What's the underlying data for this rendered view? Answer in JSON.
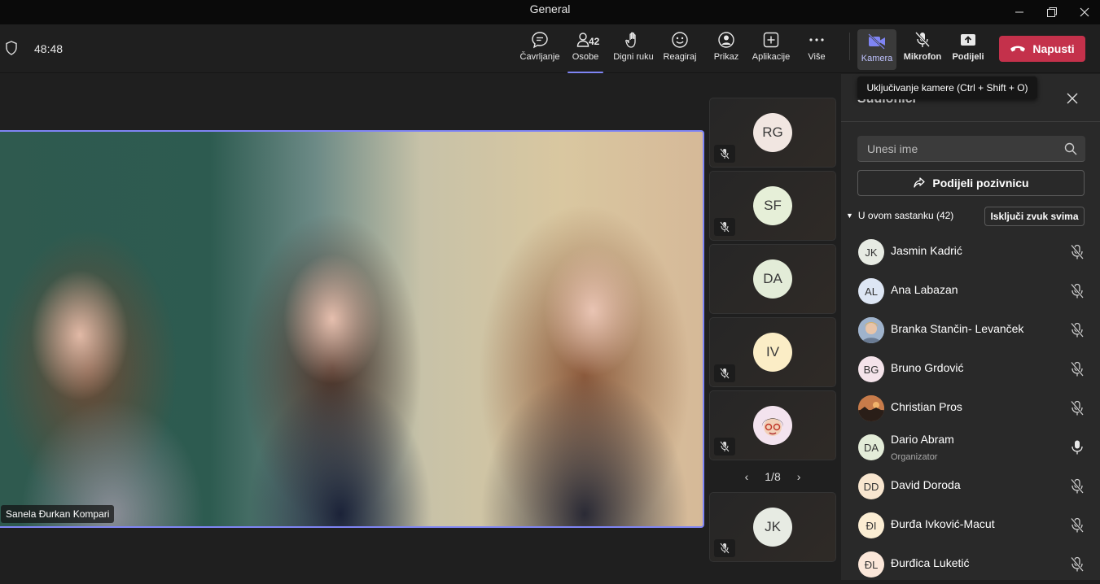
{
  "window": {
    "title": "General",
    "controls": [
      "minimize",
      "restore",
      "close"
    ]
  },
  "toolbar": {
    "timer": "48:48",
    "buttons": {
      "chat": "Čavrljanje",
      "people": "Osobe",
      "people_count": "42",
      "raise_hand": "Digni ruku",
      "react": "Reagiraj",
      "view": "Prikaz",
      "apps": "Aplikacije",
      "more": "Više",
      "camera": "Kamera",
      "mic": "Mikrofon",
      "share": "Podijeli"
    },
    "leave_label": "Napusti",
    "tooltip": "Uključivanje kamere (Ctrl + Shift + O)",
    "accent_color": "#7f85f5",
    "leave_color": "#c4314b"
  },
  "stage": {
    "main_speaker_name": "Sanela Đurkan Kompari",
    "tiles": [
      {
        "initials": "RG",
        "color": "#f1e6e1",
        "muted": true
      },
      {
        "initials": "SF",
        "color": "#e6efd8",
        "muted": true
      },
      {
        "initials": "DA",
        "color": "#e3ecd8",
        "muted": false
      },
      {
        "initials": "IV",
        "color": "#fbedc6",
        "muted": true
      },
      {
        "initials": "",
        "color": "#f3e3ee",
        "muted": true
      },
      {
        "initials": "JK",
        "color": "#e7ebe3",
        "muted": true
      }
    ],
    "pager": "1/8"
  },
  "panel": {
    "title": "Sudionici",
    "search_placeholder": "Unesi ime",
    "share_invite": "Podijeli pozivnicu",
    "section_label": "U ovom sastanku (42)",
    "mute_all": "Isključi zvuk svima",
    "participants": [
      {
        "initials": "JK",
        "name": "Jasmin Kadrić",
        "role": "",
        "color": "#e7ebe3",
        "muted": true
      },
      {
        "initials": "AL",
        "name": "Ana Labazan",
        "role": "",
        "color": "#dde6f4",
        "muted": true
      },
      {
        "initials": "",
        "name": "Branka Stančin- Levanček",
        "role": "",
        "color": "#b4c2d6",
        "muted": true
      },
      {
        "initials": "BG",
        "name": "Bruno Grdović",
        "role": "",
        "color": "#f4e3ea",
        "muted": true
      },
      {
        "initials": "",
        "name": "Christian Pros",
        "role": "",
        "color": "#8a6245",
        "muted": true
      },
      {
        "initials": "DA",
        "name": "Dario Abram",
        "role": "Organizator",
        "color": "#e3ecd8",
        "muted": false
      },
      {
        "initials": "DD",
        "name": "David Doroda",
        "role": "",
        "color": "#f8e6cf",
        "muted": true
      },
      {
        "initials": "ĐI",
        "name": "Đurđa Ivković-Macut",
        "role": "",
        "color": "#fbedd3",
        "muted": true
      },
      {
        "initials": "ĐL",
        "name": "Đurđica Luketić",
        "role": "",
        "color": "#fbe7d9",
        "muted": true
      }
    ]
  }
}
